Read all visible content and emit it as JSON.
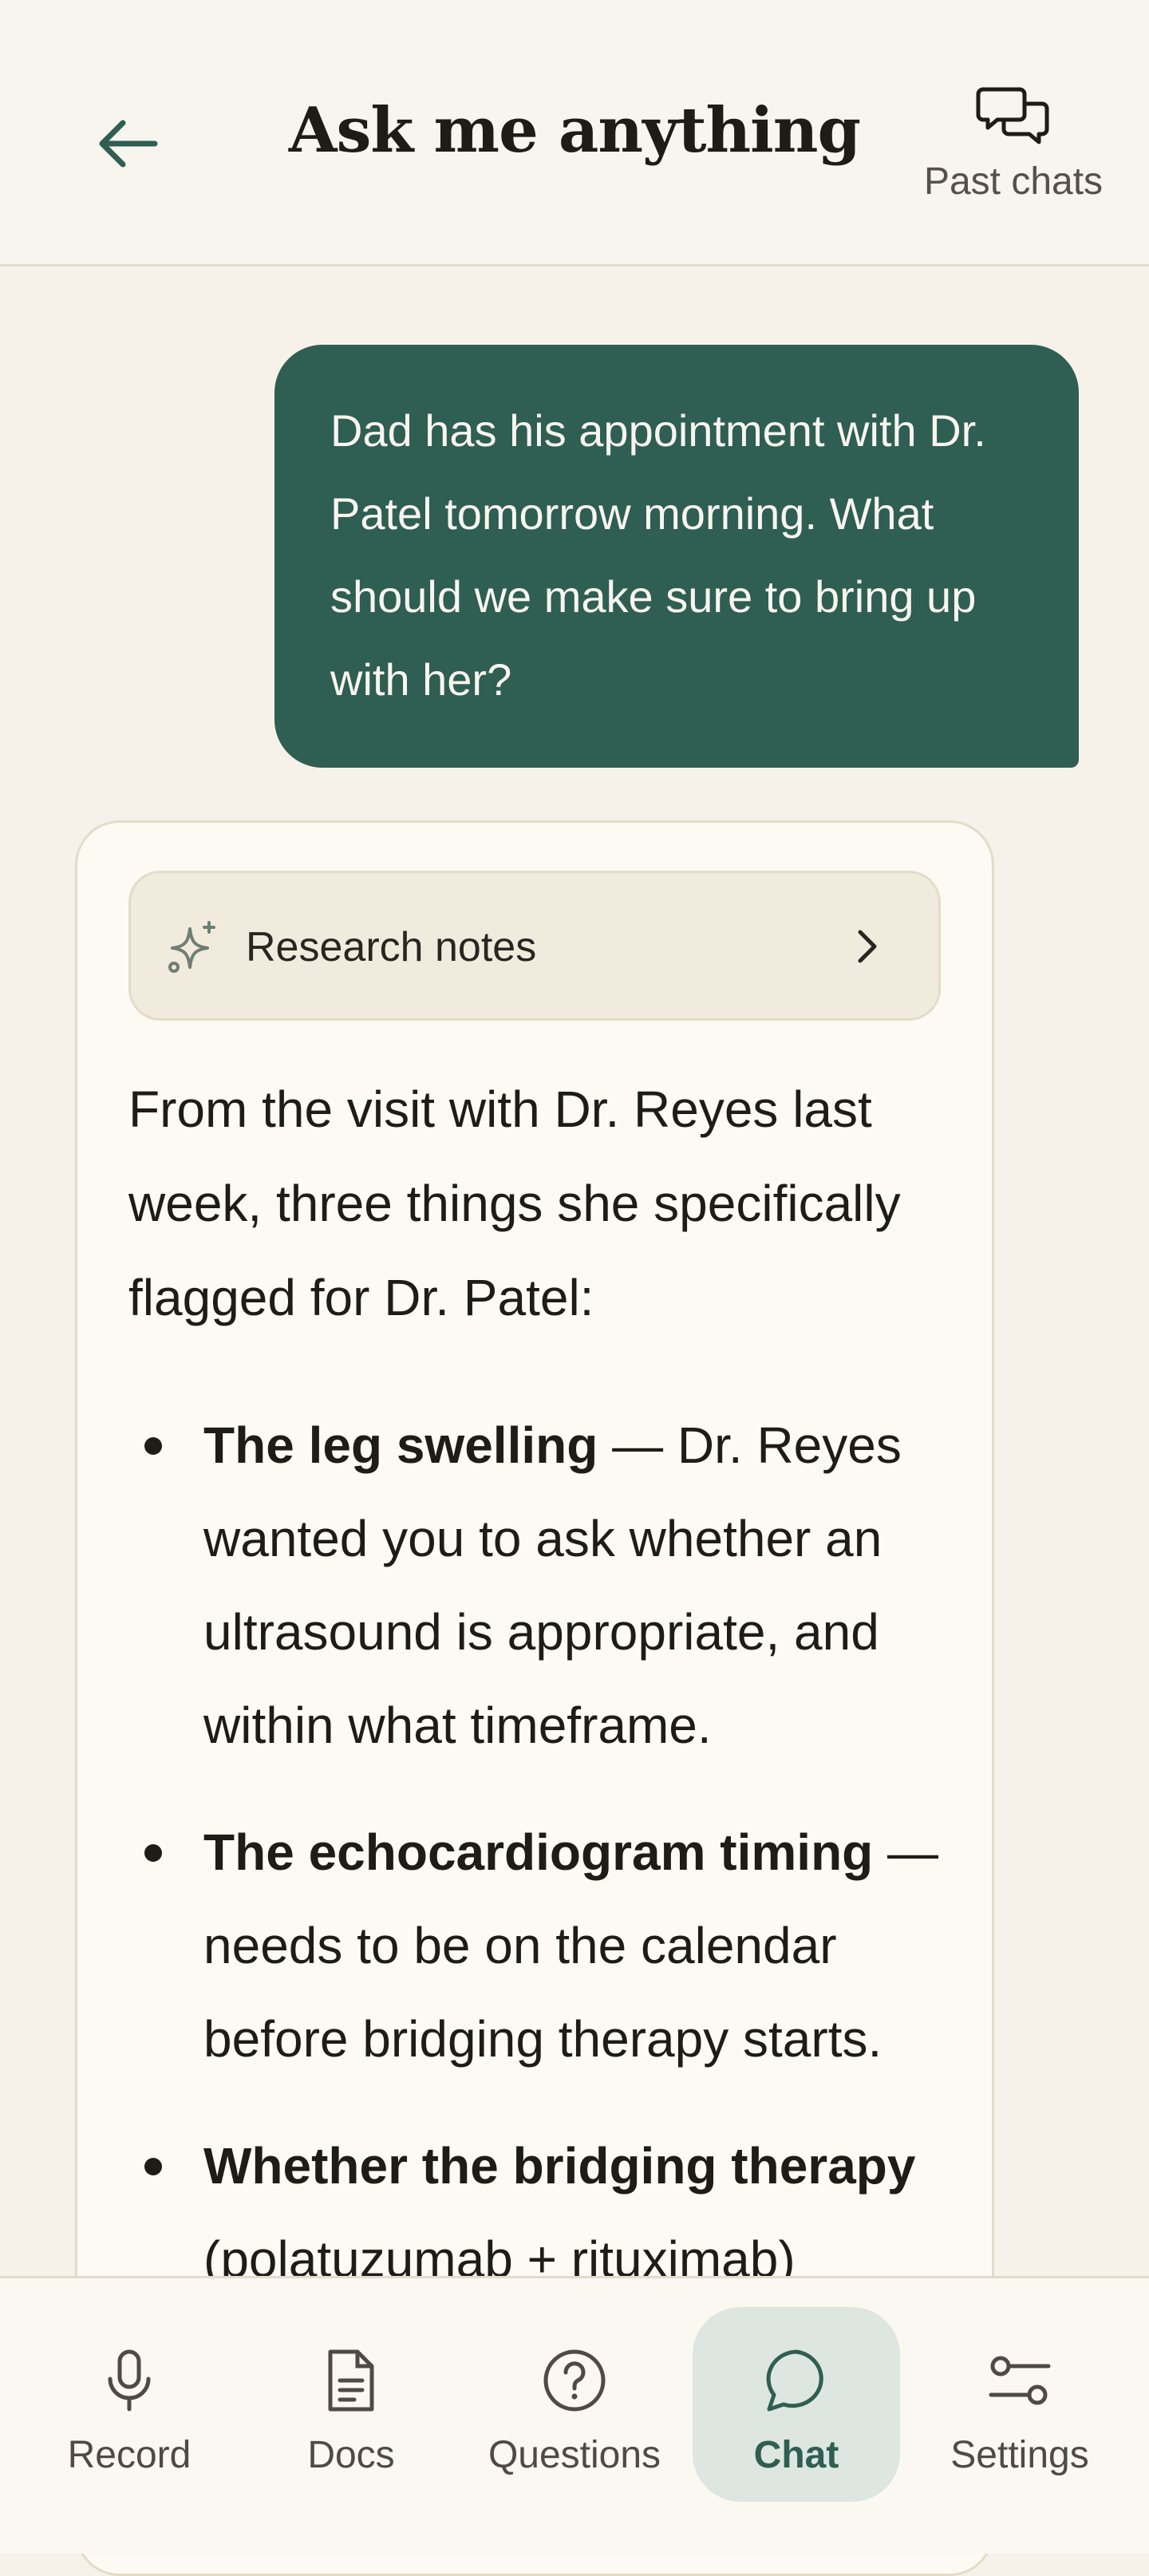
{
  "header": {
    "title": "Ask me anything",
    "back_icon": "arrow-left-icon",
    "past_chats_label": "Past chats",
    "past_chats_icon": "chat-bubbles-icon"
  },
  "conversation": {
    "user_message": "Dad has his appointment with Dr. Patel tomorrow morning. What should we make sure to bring up with her?",
    "assistant": {
      "research_notes_label": "Research notes",
      "intro": "From the visit with Dr. Reyes last week, three things she specifically flagged for Dr. Patel:",
      "bullets": [
        {
          "bold": "The leg swelling",
          "text": " — Dr. Reyes wanted you to ask whether an ultrasound is appropriate, and within what timeframe."
        },
        {
          "bold": "The echocardiogram timing",
          "text": " — needs to be on the calendar before bridging therapy starts."
        },
        {
          "bold": "Whether the bridging therapy",
          "text": " (polatuzumab + rituximab)"
        }
      ]
    }
  },
  "nav": {
    "items": [
      {
        "label": "Record",
        "icon": "microphone-icon"
      },
      {
        "label": "Docs",
        "icon": "document-icon"
      },
      {
        "label": "Questions",
        "icon": "question-circle-icon"
      },
      {
        "label": "Chat",
        "icon": "chat-bubble-icon",
        "active": true
      },
      {
        "label": "Settings",
        "icon": "sliders-icon"
      }
    ]
  },
  "colors": {
    "accent": "#2f5e52",
    "background": "#f6f2ea",
    "active_nav_bg": "#dde6e0"
  }
}
